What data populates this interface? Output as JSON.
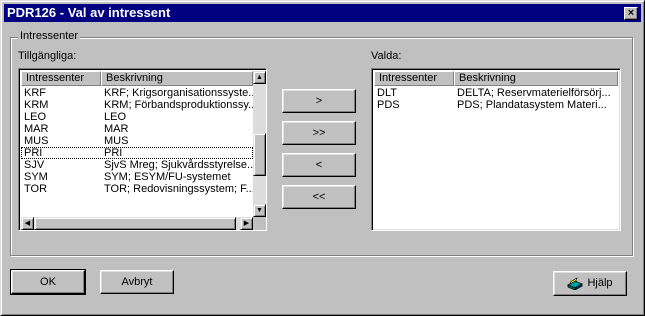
{
  "window": {
    "title": "PDR126 - Val av intressent",
    "close_symbol": "×"
  },
  "group": {
    "legend": "Intressenter"
  },
  "available": {
    "label": "Tillgängliga:",
    "columns": [
      "Intressenter",
      "Beskrivning"
    ],
    "rows": [
      {
        "code": "KRF",
        "desc": "KRF; Krigsorganisationssyste..."
      },
      {
        "code": "KRM",
        "desc": "KRM; Förbandsproduktionssy..."
      },
      {
        "code": "LEO",
        "desc": "LEO"
      },
      {
        "code": "MAR",
        "desc": "MAR"
      },
      {
        "code": "MUS",
        "desc": "MUS"
      },
      {
        "code": "PRI",
        "desc": "PRI"
      },
      {
        "code": "SJV",
        "desc": "SjvS Mreg; Sjukvårdsstyrelse..."
      },
      {
        "code": "SYM",
        "desc": "SYM; ESYM/FU-systemet"
      },
      {
        "code": "TOR",
        "desc": "TOR; Redovisningssystem; F..."
      }
    ],
    "focused_code": "PRI"
  },
  "selected": {
    "label": "Valda:",
    "columns": [
      "Intressenter",
      "Beskrivning"
    ],
    "rows": [
      {
        "code": "DLT",
        "desc": "DELTA; Reservmaterielförsörj..."
      },
      {
        "code": "PDS",
        "desc": "PDS; Plandatasystem Materi..."
      }
    ]
  },
  "transfer": {
    "add_one": ">",
    "add_all": ">>",
    "remove_one": "<",
    "remove_all": "<<"
  },
  "footer": {
    "ok": "OK",
    "cancel": "Avbryt",
    "help": "Hjälp"
  },
  "icons": {
    "close": "close-icon",
    "help": "help-book-icon",
    "scroll_up": "arrow-up-icon",
    "scroll_down": "arrow-down-icon",
    "scroll_left": "arrow-left-icon",
    "scroll_right": "arrow-right-icon"
  },
  "colors": {
    "titlebar": "#000080",
    "face": "#c0c0c0"
  }
}
